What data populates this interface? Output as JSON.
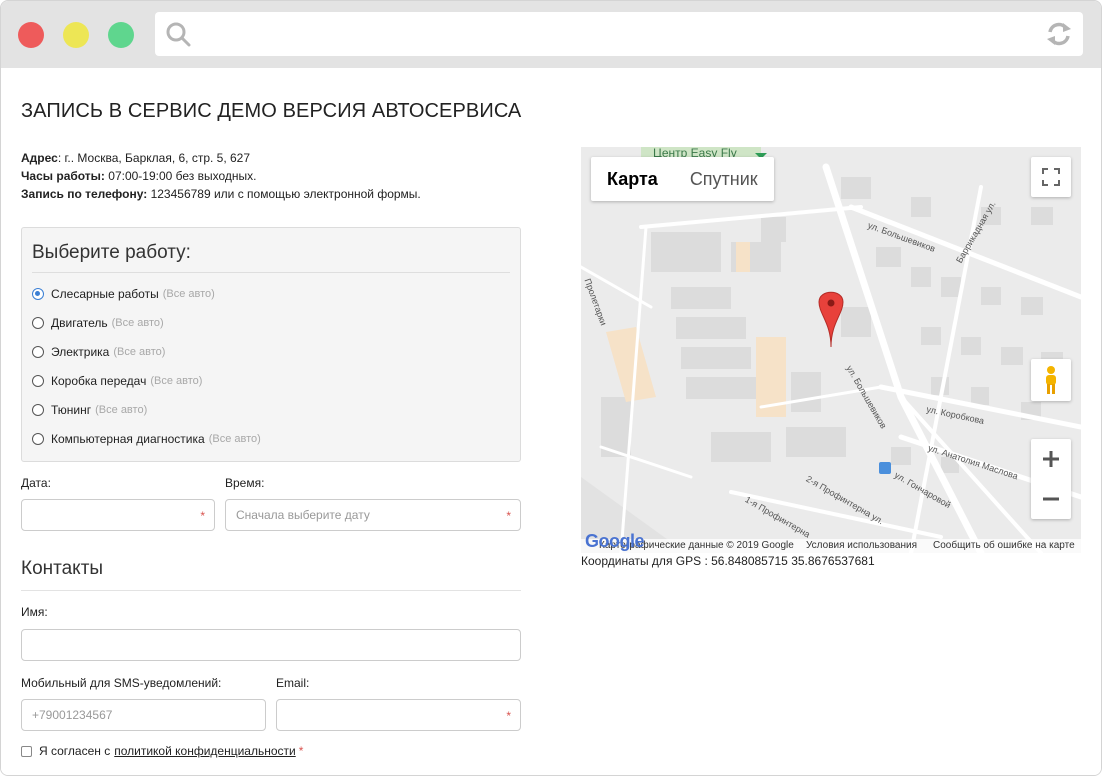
{
  "title": "ЗАПИСЬ В СЕРВИС ДЕМО ВЕРСИЯ АВТОСЕРВИСА",
  "info": {
    "address_label": "Адрес",
    "address_value": ": г.. Москва, Барклая, 6, стр. 5, 627",
    "hours_label": "Часы работы:",
    "hours_value": " 07:00-19:00 без выходных.",
    "phone_label": "Запись по телефону:",
    "phone_value": " 123456789 или с помощью электронной формы."
  },
  "work": {
    "heading": "Выберите работу:",
    "items": [
      {
        "label": "Слесарные работы",
        "note": "(Все авто)",
        "checked": true
      },
      {
        "label": "Двигатель",
        "note": "(Все авто)",
        "checked": false
      },
      {
        "label": "Электрика",
        "note": "(Все авто)",
        "checked": false
      },
      {
        "label": "Коробка передач",
        "note": "(Все авто)",
        "checked": false
      },
      {
        "label": "Тюнинг",
        "note": "(Все авто)",
        "checked": false
      },
      {
        "label": "Компьютерная диагностика",
        "note": "(Все авто)",
        "checked": false
      }
    ]
  },
  "form": {
    "date_label": "Дата:",
    "date_value": "",
    "time_label": "Время:",
    "time_placeholder": "Сначала выберите дату",
    "required_mark": "*",
    "contacts_heading": "Контакты",
    "name_label": "Имя:",
    "name_value": "",
    "mobile_label": "Мобильный для SMS-уведомлений:",
    "mobile_placeholder": "+79001234567",
    "email_label": "Email:",
    "email_value": "",
    "consent_text": "Я согласен с",
    "consent_link": "политикой конфиденциальности",
    "consent_star": "*"
  },
  "map": {
    "tab_map": "Карта",
    "tab_satellite": "Спутник",
    "poi_top": "Центр Easy Fly",
    "streets": {
      "bolshevikov": "ул. Большевиков",
      "barrikadnaya": "Баррикадная ул.",
      "proletarki": "Пролетарки",
      "bolshevikov2": "ул. Большевиков",
      "korobkova": "ул. Коробкова",
      "maslova": "ул. Анатолия Маслова",
      "goncharova": "ул. Гончаровой",
      "profintern2": "2-я Профинтерна ул.",
      "profintern1": "1-я Профинтерна"
    },
    "footer_copy": "Картографические данные © 2019 Google",
    "footer_terms": "Условия использования",
    "footer_report": "Сообщить об ошибке на карте",
    "google_logo": "Google",
    "marker_color": "#e8413b"
  },
  "gps": "Координаты для GPS : 56.848085715 35.8676537681",
  "colors": {
    "accent": "#3b7fd4",
    "required": "#d9534f"
  }
}
